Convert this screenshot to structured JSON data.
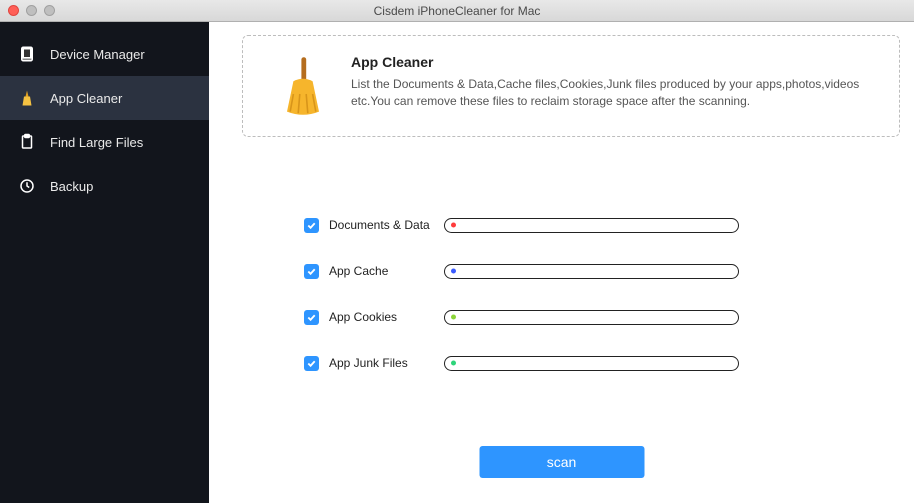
{
  "window": {
    "title": "Cisdem iPhoneCleaner for Mac"
  },
  "sidebar": {
    "items": [
      {
        "label": "Device Manager"
      },
      {
        "label": "App Cleaner"
      },
      {
        "label": "Find Large Files"
      },
      {
        "label": "Backup"
      }
    ]
  },
  "main": {
    "info_title": "App Cleaner",
    "info_desc": "List the Documents & Data,Cache files,Cookies,Junk files produced by your apps,photos,videos etc.You can remove these files to reclaim storage space after the scanning.",
    "categories": [
      {
        "label": "Documents & Data",
        "color": "#ff3b3b",
        "checked": true
      },
      {
        "label": "App Cache",
        "color": "#3b5bff",
        "checked": true
      },
      {
        "label": "App Cookies",
        "color": "#8bd438",
        "checked": true
      },
      {
        "label": "App Junk Files",
        "color": "#2ed47a",
        "checked": true
      }
    ],
    "scan_label": "scan"
  }
}
